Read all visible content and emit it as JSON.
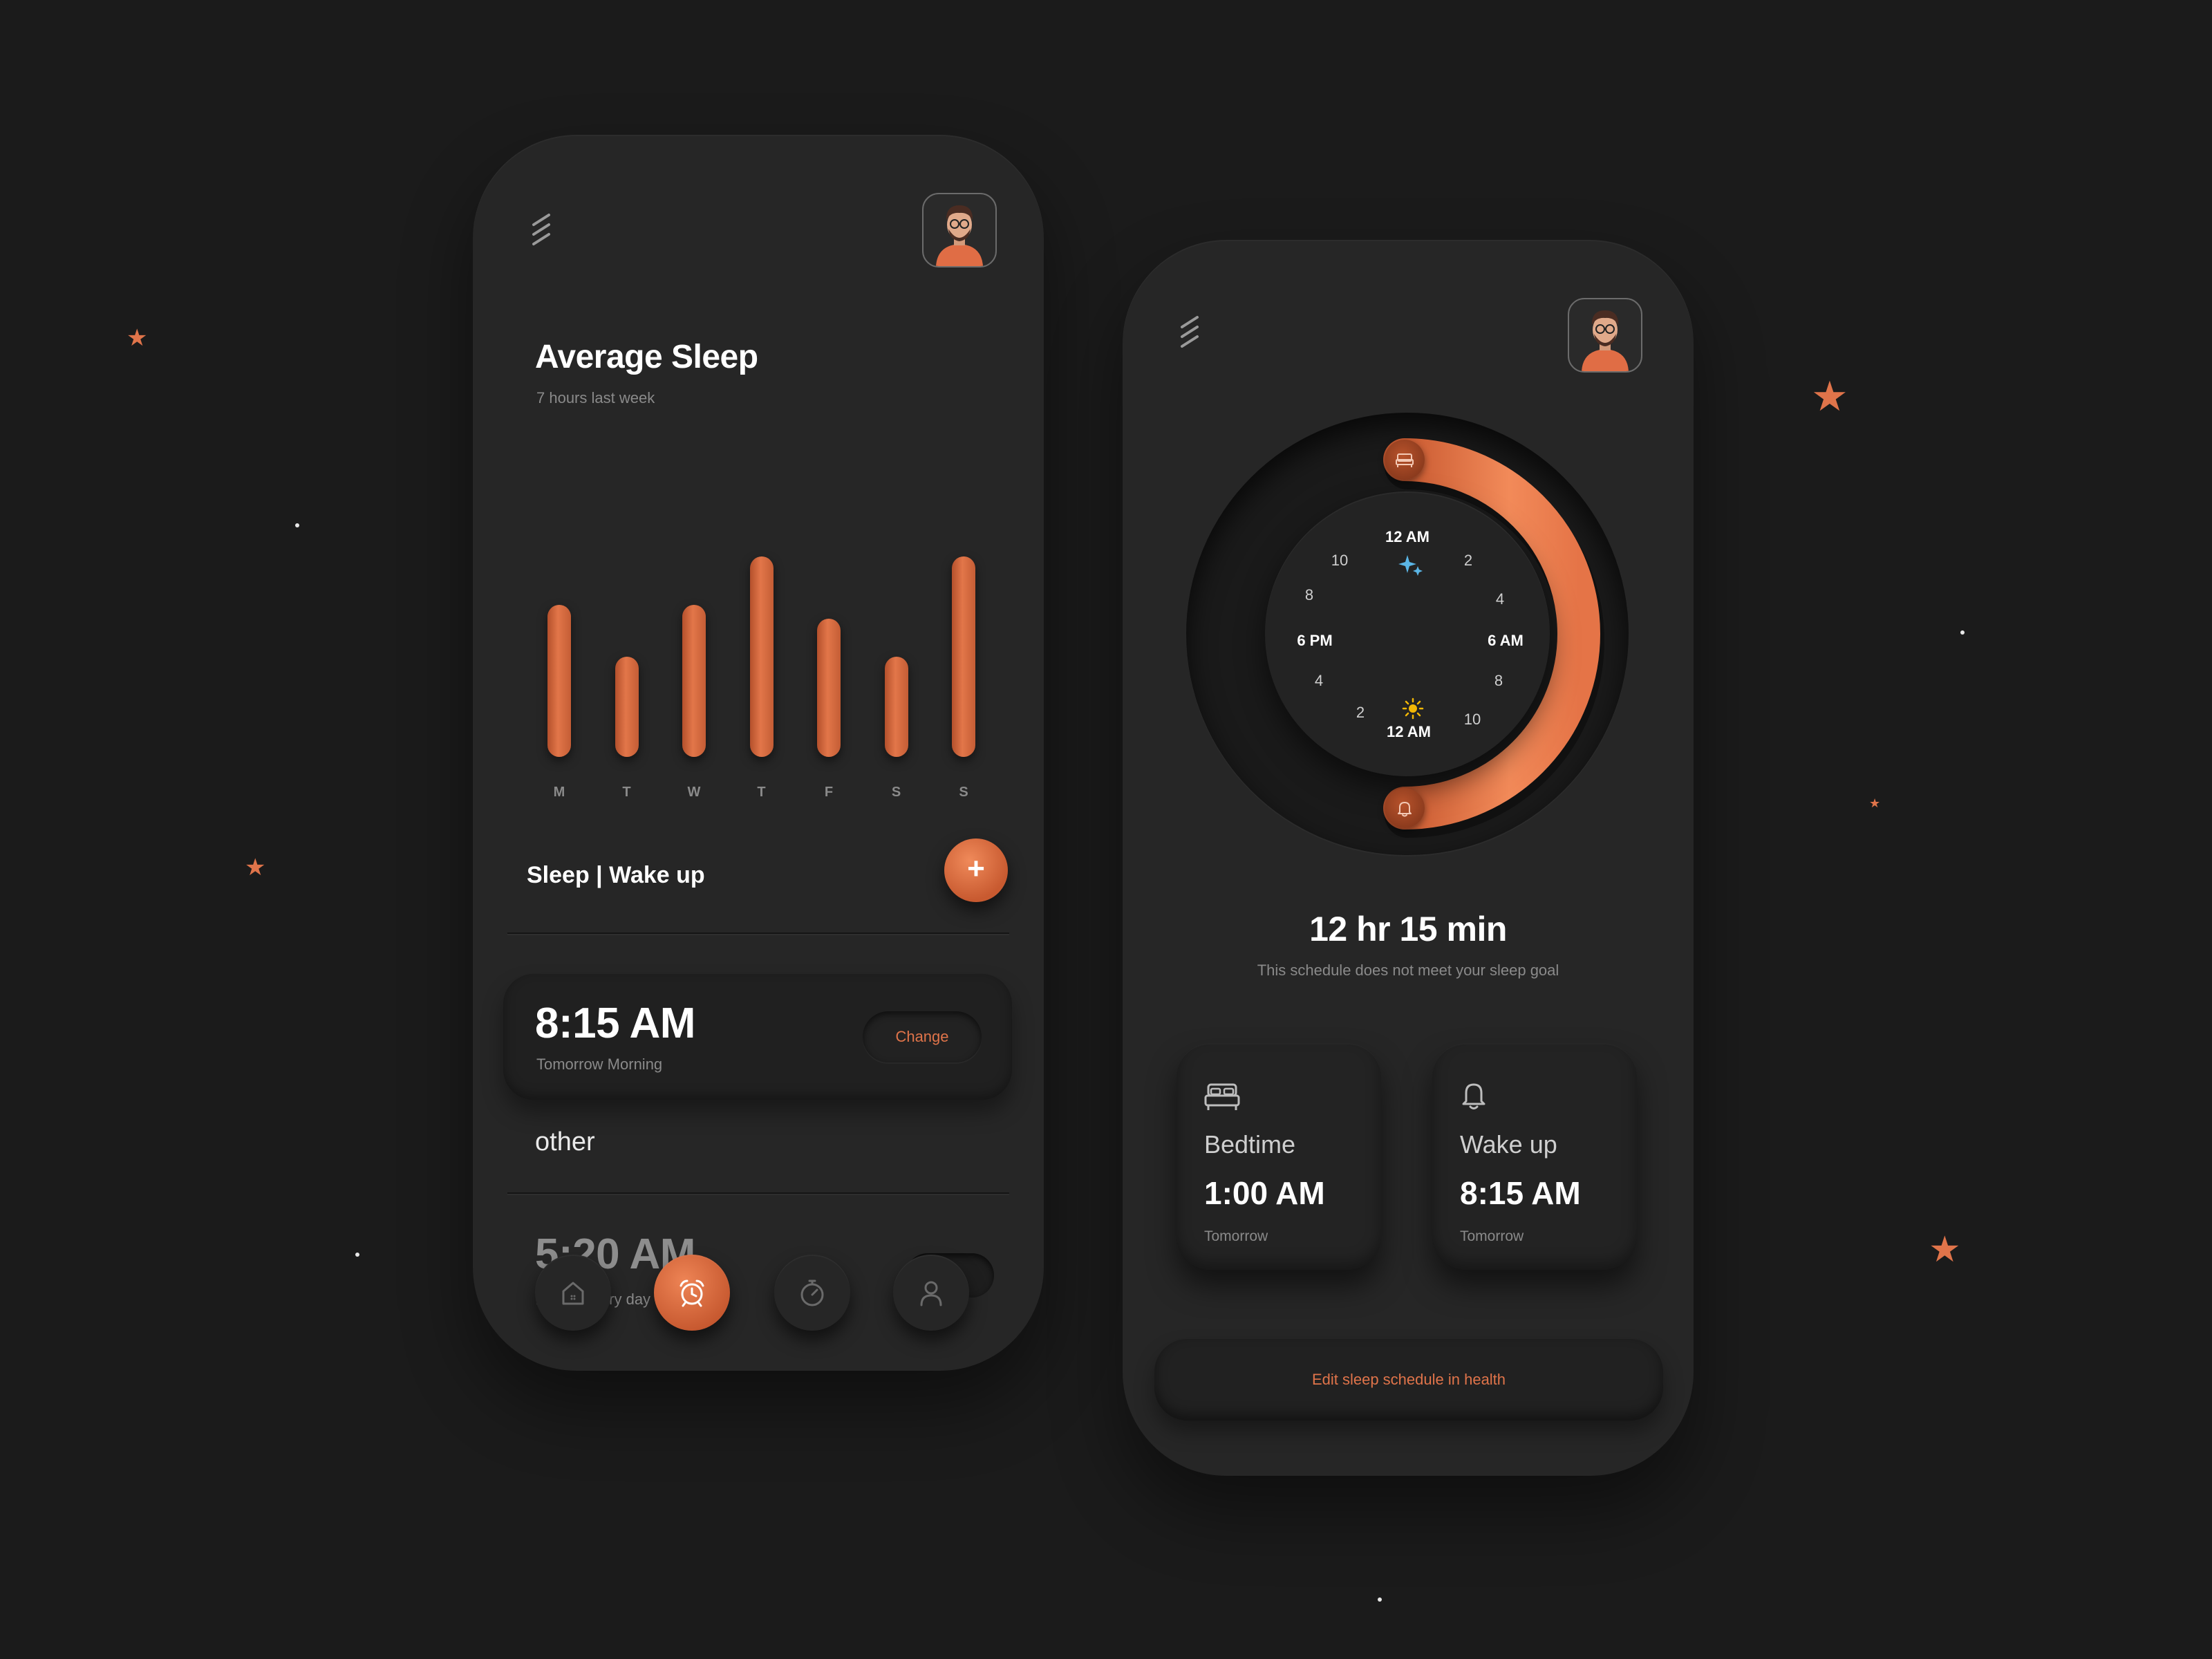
{
  "colors": {
    "background": "#1b1b1b",
    "phone": "#262626",
    "accent": "#e0744a",
    "text_primary": "#ffffff",
    "text_muted": "#8a8a8a"
  },
  "left_screen": {
    "menu_icon": "menu-icon",
    "avatar": "user-avatar",
    "title": "Average Sleep",
    "subtitle": "7 hours last week",
    "chart_data": {
      "type": "bar",
      "categories": [
        "M",
        "T",
        "W",
        "T",
        "F",
        "S",
        "S"
      ],
      "values": [
        0.76,
        0.5,
        0.76,
        1.0,
        0.69,
        0.5,
        1.0
      ],
      "ylim": [
        0,
        1
      ]
    },
    "section_title": "Sleep | Wake up",
    "add_icon": "+",
    "primary_alarm": {
      "time": "8:15 AM",
      "note": "Tomorrow Morning",
      "change_label": "Change"
    },
    "other_label": "other",
    "other_alarm": {
      "time": "5:20 AM",
      "note": "Alarm, every day",
      "enabled": false
    },
    "nav": [
      {
        "icon": "home-icon",
        "active": false
      },
      {
        "icon": "alarm-clock-icon",
        "active": true
      },
      {
        "icon": "stopwatch-icon",
        "active": false
      },
      {
        "icon": "profile-icon",
        "active": false
      }
    ]
  },
  "right_screen": {
    "menu_icon": "menu-icon",
    "avatar": "user-avatar",
    "dial": {
      "top_label": "12 AM",
      "bottom_label": "12 AM",
      "left_label": "6 PM",
      "right_label": "6 AM",
      "numbers": [
        "2",
        "4",
        "8",
        "10",
        "8",
        "4",
        "2",
        "10"
      ],
      "bedtime_icon": "bed-icon",
      "wake_icon": "bell-icon",
      "night_icon": "sparkle-icon",
      "day_icon": "sun-icon"
    },
    "duration": "12 hr 15 min",
    "goal_message": "This schedule does not meet your sleep goal",
    "bedtime": {
      "icon": "bed-icon",
      "label": "Bedtime",
      "time": "1:00 AM",
      "day": "Tomorrow"
    },
    "wake": {
      "icon": "bell-icon",
      "label": "Wake up",
      "time": "8:15 AM",
      "day": "Tomorrow"
    },
    "edit_link": "Edit sleep schedule in health"
  }
}
